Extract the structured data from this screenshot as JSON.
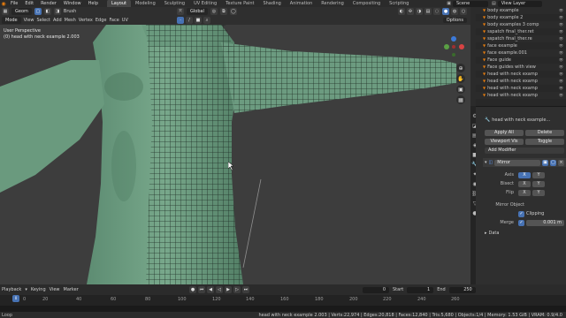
{
  "menu": {
    "items": [
      "File",
      "Edit",
      "Render",
      "Window",
      "Help"
    ]
  },
  "workspaces": {
    "tabs": [
      "Layout",
      "Modeling",
      "Sculpting",
      "UV Editing",
      "Texture Paint",
      "Shading",
      "Animation",
      "Rendering",
      "Compositing",
      "Scripting"
    ],
    "active": "Layout"
  },
  "scene": {
    "name": "Scene"
  },
  "view_layer": {
    "name": "View Layer"
  },
  "viewport_header": {
    "mode": "Geom",
    "brush": "Brush",
    "mode_select": "Mode",
    "menus": [
      "View",
      "Select",
      "Add",
      "Mesh",
      "Vertex",
      "Edge",
      "Face",
      "UV"
    ],
    "transform": "Global",
    "options": "Options"
  },
  "viewport": {
    "view_name": "User Perspective",
    "object_info": "(0) head with neck example 2.003"
  },
  "outliner": {
    "rows": [
      "body example",
      "body example 2",
      "body examples 3 comp",
      "sspatch final_ther.ret",
      "sspatch final_ther.re",
      "face example",
      "face example.001",
      "Face guide",
      "Face guides with view",
      "head with neck examp",
      "head with neck examp",
      "head with neck examp",
      "head with neck examp"
    ]
  },
  "properties": {
    "object_name": "head with neck example...",
    "apply_all": "Apply All",
    "delete_all": "Delete",
    "viewport_vis": "Viewport Vis",
    "toggle": "Toggle",
    "add_modifier": "Add Modifier",
    "modifier_name": "Mirror",
    "axis_label": "Axis",
    "bisect_label": "Bisect",
    "flip_label": "Flip",
    "x": "X",
    "y": "Y",
    "mirror_object_label": "Mirror Object",
    "clipping_label": "Clipping",
    "merge_label": "Merge",
    "merge_value": "0.001 m",
    "data_label": "Data"
  },
  "timeline": {
    "playback": "Playback",
    "keying": "Keying",
    "view": "View",
    "marker": "Marker",
    "current_frame": "0",
    "start_label": "Start",
    "start": "1",
    "end_label": "End",
    "end": "250",
    "ruler_ticks": [
      "0",
      "20",
      "40",
      "60",
      "80",
      "100",
      "120",
      "140",
      "160",
      "180",
      "200",
      "220",
      "240",
      "260"
    ],
    "playhead": "0"
  },
  "status": {
    "left": "Loop",
    "right": "head with neck example 2.003 | Verts:22,974 | Edges:20,818 | Faces:12,840 | Tris:5,680 | Objects:1/4 | Memory: 1.53 GiB | VRAM: 0.9/4.0"
  },
  "colors": {
    "accent": "#4772b3",
    "orange": "#e87d0d",
    "mesh_green": "#6c9b7f"
  }
}
